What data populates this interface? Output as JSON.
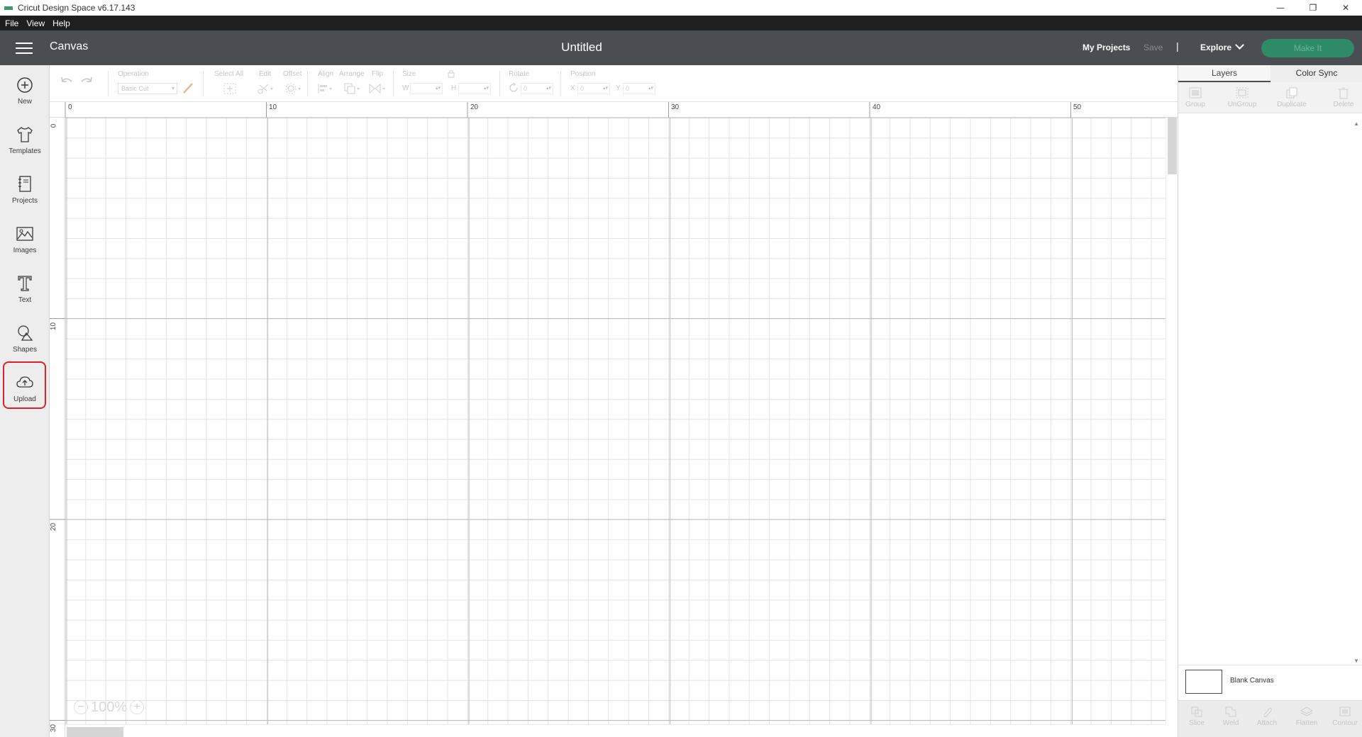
{
  "window": {
    "title": "Cricut Design Space  v6.17.143",
    "controls": [
      "minimize-icon",
      "restore-icon",
      "close-icon"
    ]
  },
  "menu": [
    "File",
    "View",
    "Help"
  ],
  "header": {
    "section": "Canvas",
    "project_title": "Untitled",
    "my_projects": "My Projects",
    "save": "Save",
    "separator": "|",
    "explore": "Explore",
    "make_it": "Make It"
  },
  "sidebar": {
    "items": [
      {
        "label": "New",
        "icon": "plus-circle-icon"
      },
      {
        "label": "Templates",
        "icon": "tshirt-icon"
      },
      {
        "label": "Projects",
        "icon": "notebook-icon"
      },
      {
        "label": "Images",
        "icon": "image-icon"
      },
      {
        "label": "Text",
        "icon": "text-t-icon"
      },
      {
        "label": "Shapes",
        "icon": "shapes-icon"
      },
      {
        "label": "Upload",
        "icon": "cloud-upload-icon"
      }
    ],
    "highlighted_item": "Upload",
    "highlight_color": "#e0202b"
  },
  "toolbar": {
    "operation_label": "Operation",
    "operation_value": "Basic Cut",
    "select_all": "Select All",
    "edit": "Edit",
    "offset": "Offset",
    "align": "Align",
    "arrange": "Arrange",
    "flip": "Flip",
    "size": "Size",
    "w": "W",
    "h": "H",
    "rotate": "Rotate",
    "rotate_value": "0",
    "position": "Position",
    "x": "X",
    "x_value": "0",
    "y": "Y",
    "y_value": "0"
  },
  "canvas": {
    "ruler_top": [
      "0",
      "10",
      "20",
      "30",
      "40",
      "50"
    ],
    "ruler_left": [
      "0",
      "10",
      "20",
      "30"
    ],
    "zoom": "100%",
    "zoom_out": "−",
    "zoom_in": "+"
  },
  "right_panel": {
    "tabs": [
      "Layers",
      "Color Sync"
    ],
    "active_tab": "Layers",
    "top_tools": [
      "Group",
      "UnGroup",
      "Duplicate",
      "Delete"
    ],
    "layer_name": "Blank Canvas",
    "bottom_tools": [
      "Slice",
      "Weld",
      "Attach",
      "Flatten",
      "Contour"
    ]
  },
  "colors": {
    "header_bg": "#4a4d52",
    "make_it_bg": "#2f8a68",
    "menu_bg": "#1f1f1f"
  }
}
